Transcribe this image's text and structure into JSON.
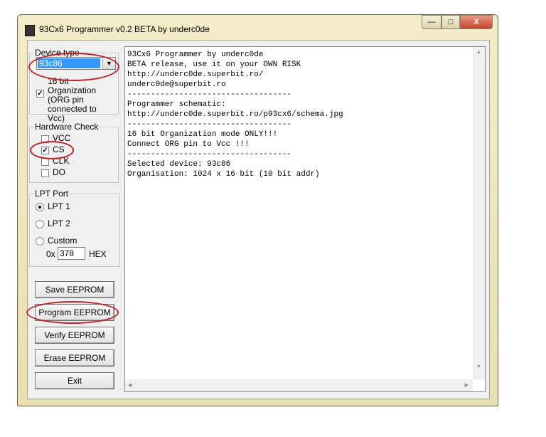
{
  "window": {
    "title": "93Cx6 Programmer v0.2 BETA by underc0de",
    "controls": {
      "minimize": "—",
      "maximize": "□",
      "close": "X"
    }
  },
  "device_type": {
    "legend": "Device type",
    "selected": "93c86",
    "org_checkbox_label": "16 bit Organization (ORG pin connected to Vcc)",
    "org_checked": true
  },
  "hardware_check": {
    "legend": "Hardware Check",
    "items": [
      {
        "label": "VCC",
        "checked": false
      },
      {
        "label": "CS",
        "checked": true
      },
      {
        "label": "CLK",
        "checked": false
      },
      {
        "label": "DO",
        "checked": false
      }
    ]
  },
  "lpt_port": {
    "legend": "LPT Port",
    "options": [
      {
        "label": "LPT 1",
        "selected": true
      },
      {
        "label": "LPT 2",
        "selected": false
      },
      {
        "label": "Custom",
        "selected": false
      }
    ],
    "prefix": "0x",
    "address": "378",
    "suffix": "HEX"
  },
  "buttons": {
    "save": "Save EEPROM",
    "program": "Program EEPROM",
    "verify": "Verify EEPROM",
    "erase": "Erase EEPROM",
    "exit": "Exit"
  },
  "log": {
    "lines": [
      "93Cx6 Programmer by underc0de",
      "BETA release, use it on your OWN RISK",
      "http://underc0de.superbit.ro/",
      "underc0de@superbit.ro",
      "-----------------------------------",
      "Programmer schematic:",
      "http://underc0de.superbit.ro/p93cx6/schema.jpg",
      "-----------------------------------",
      "16 bit Organization mode ONLY!!!",
      "Connect ORG pin to Vcc !!!",
      "-----------------------------------",
      "Selected device: 93c86",
      "Organisation: 1024 x 16 bit (10 bit addr)"
    ]
  },
  "colors": {
    "annotation": "#c0202a",
    "selection": "#3399ff"
  }
}
